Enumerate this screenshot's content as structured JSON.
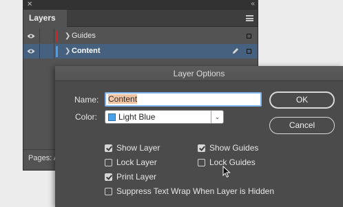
{
  "panel": {
    "tab_label": "Layers",
    "close_glyph": "✕",
    "collapse_glyph": "‹‹",
    "layers": [
      {
        "name": "Guides",
        "color": "#d42121",
        "visible": true,
        "selected": false
      },
      {
        "name": "Content",
        "color": "#4aa0e8",
        "visible": true,
        "selected": true
      }
    ],
    "pages_label": "Pages: A"
  },
  "dialog": {
    "title": "Layer Options",
    "name_label": "Name:",
    "name_value": "Content",
    "color_label": "Color:",
    "color_value": "Light Blue",
    "color_swatch": "#4aa0e8",
    "ok_label": "OK",
    "cancel_label": "Cancel",
    "options": {
      "show_layer": {
        "label": "Show Layer",
        "checked": true
      },
      "lock_layer": {
        "label": "Lock Layer",
        "checked": false
      },
      "print_layer": {
        "label": "Print Layer",
        "checked": true
      },
      "suppress_text_wrap": {
        "label": "Suppress Text Wrap When Layer is Hidden",
        "checked": false
      },
      "show_guides": {
        "label": "Show Guides",
        "checked": true
      },
      "lock_guides": {
        "label": "Lock Guides",
        "checked": false
      }
    }
  },
  "icons": {
    "visibility": "eye-icon",
    "edit": "pencil-icon",
    "expand": "chevron-right-icon",
    "menu": "hamburger-menu-icon",
    "pointer": "mouse-cursor-icon"
  }
}
